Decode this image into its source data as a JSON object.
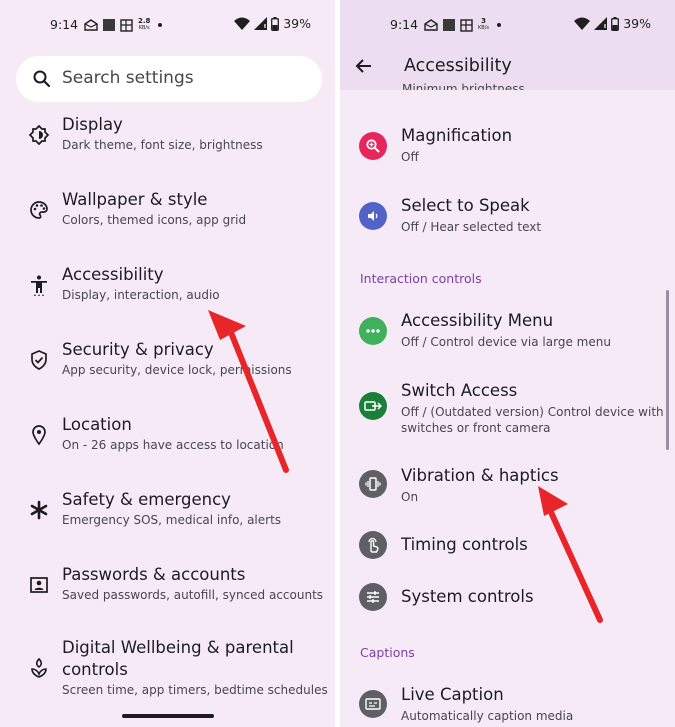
{
  "status_left": {
    "time": "9:14",
    "rate_value": "2.8",
    "rate_unit": "KB/s",
    "battery": "39%"
  },
  "status_right": {
    "time": "9:14",
    "rate_value": "3",
    "rate_unit": "KB/s",
    "battery": "39%"
  },
  "search": {
    "placeholder": "Search settings"
  },
  "settings_items": [
    {
      "title": "Display",
      "subtitle": "Dark theme, font size, brightness",
      "icon": "brightness-icon"
    },
    {
      "title": "Wallpaper & style",
      "subtitle": "Colors, themed icons, app grid",
      "icon": "palette-icon"
    },
    {
      "title": "Accessibility",
      "subtitle": "Display, interaction, audio",
      "icon": "accessibility-icon"
    },
    {
      "title": "Security & privacy",
      "subtitle": "App security, device lock, permissions",
      "icon": "shield-icon"
    },
    {
      "title": "Location",
      "subtitle": "On - 26 apps have access to location",
      "icon": "location-pin-icon"
    },
    {
      "title": "Safety & emergency",
      "subtitle": "Emergency SOS, medical info, alerts",
      "icon": "asterisk-icon"
    },
    {
      "title": "Passwords & accounts",
      "subtitle": "Saved passwords, autofill, synced accounts",
      "icon": "account-box-icon"
    },
    {
      "title": "Digital Wellbeing & parental controls",
      "subtitle": "Screen time, app timers, bedtime schedules",
      "icon": "wellbeing-icon"
    }
  ],
  "accessibility": {
    "title": "Accessibility",
    "clipped_text": "Minimum brightness",
    "items_top": [
      {
        "title": "Magnification",
        "subtitle": "Off",
        "icon": "magnify-icon",
        "color": "#e8265e"
      },
      {
        "title": "Select to Speak",
        "subtitle": "Off / Hear selected text",
        "icon": "speaker-icon",
        "color": "#5163c6"
      }
    ],
    "section_interaction": "Interaction controls",
    "items_interaction": [
      {
        "title": "Accessibility Menu",
        "subtitle": "Off / Control device via large menu",
        "icon": "dots-menu-icon",
        "color": "#3fb05c"
      },
      {
        "title": "Switch Access",
        "subtitle": "Off / (Outdated version) Control device with switches or front camera",
        "icon": "switch-access-icon",
        "color": "#1b7f3a"
      },
      {
        "title": "Vibration & haptics",
        "subtitle": "On",
        "icon": "vibration-icon",
        "color": "#5f5f66"
      },
      {
        "title": "Timing controls",
        "subtitle": "",
        "icon": "touch-hand-icon",
        "color": "#5f5f66"
      },
      {
        "title": "System controls",
        "subtitle": "",
        "icon": "sliders-icon",
        "color": "#5f5f66"
      }
    ],
    "section_captions": "Captions",
    "items_captions": [
      {
        "title": "Live Caption",
        "subtitle": "Automatically caption media",
        "icon": "caption-icon",
        "color": "#5f5f66"
      }
    ]
  },
  "colors": {
    "panel_bg": "#f6eaf7",
    "header_bg": "#ecdef0",
    "section": "#7a3fa8",
    "arrow": "#e8262a"
  }
}
